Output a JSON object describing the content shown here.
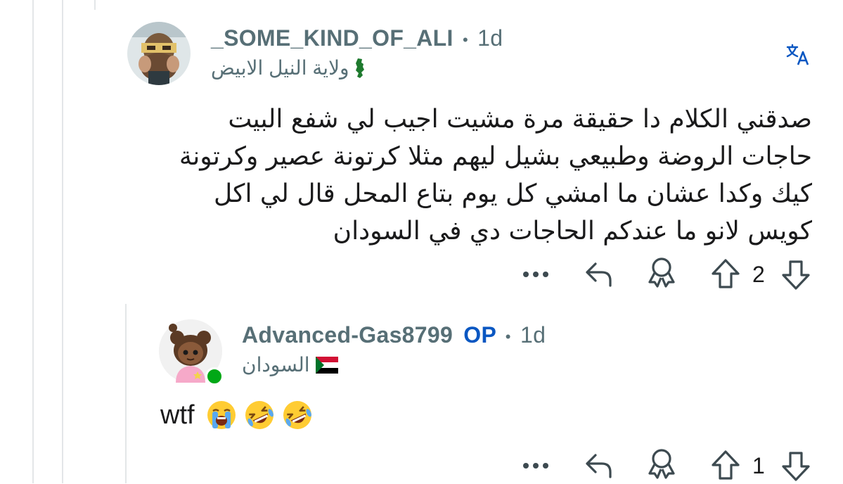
{
  "comment1": {
    "username": "_SOME_KIND_OF_ALI",
    "separator": "•",
    "age": "1d",
    "flair": "ولاية النيل الابيض",
    "flair_icon": "state-map-icon",
    "avatar_icon": "pixel-avatar-icon",
    "translate_icon": "translate-icon",
    "body_lines": [
      "صدقني الكلام دا حقيقة مرة مشيت اجيب لي شفع البيت",
      "حاجات الروضة وطبيعي بشيل ليهم مثلا كرتونة عصير وكرتونة",
      "كيك وكدا عشان ما امشي كل يوم بتاع المحل قال لي اكل",
      "كويس لانو ما عندكم الحاجات دي في السودان"
    ],
    "votes": "2",
    "actions": [
      "more-icon",
      "reply-icon",
      "award-icon",
      "upvote-icon",
      "downvote-icon"
    ]
  },
  "comment2": {
    "username": "Advanced-Gas8799",
    "op_label": "OP",
    "separator": "•",
    "age": "1d",
    "flair": "السودان",
    "flair_icon": "sudan-flag-icon",
    "online_color": "#01a816",
    "body_text": "wtf",
    "emojis": [
      "loudly-crying-face",
      "rolling-on-floor-laughing",
      "rolling-on-floor-laughing"
    ],
    "votes": "1",
    "actions": [
      "more-icon",
      "reply-icon",
      "award-icon",
      "upvote-icon",
      "downvote-icon"
    ]
  },
  "colors": {
    "meta": "#576f76",
    "op": "#0a57c2",
    "icon": "#576f76",
    "thread_line": "#e3e6e8"
  }
}
